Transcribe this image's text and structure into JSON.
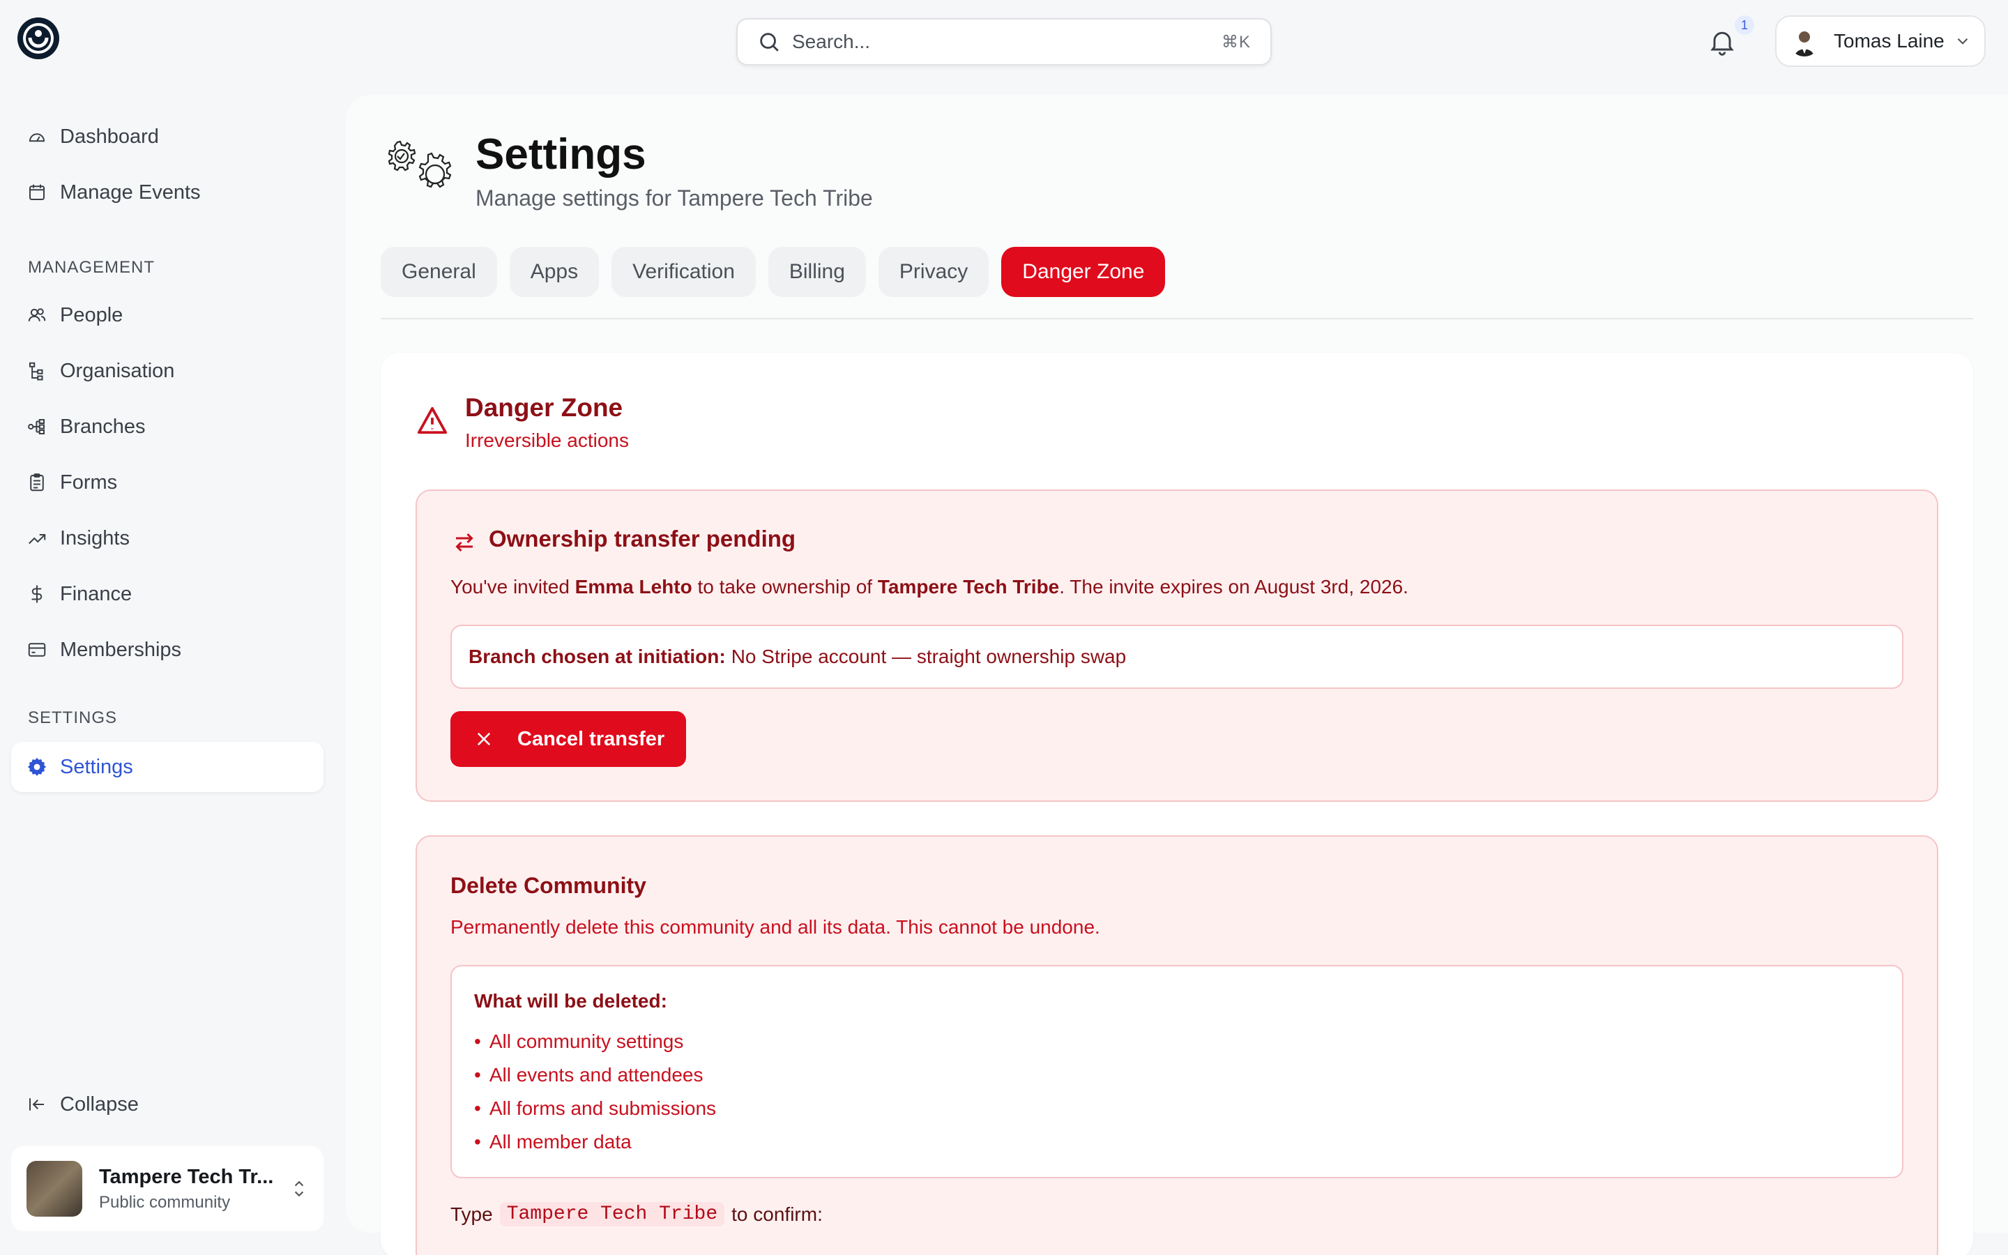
{
  "topbar": {
    "search_placeholder": "Search...",
    "search_shortcut": "⌘K",
    "notification_count": "1",
    "user_name": "Tomas Laine"
  },
  "sidebar": {
    "items_top": [
      {
        "label": "Dashboard",
        "icon": "gauge-icon"
      },
      {
        "label": "Manage Events",
        "icon": "calendar-icon"
      }
    ],
    "management_heading": "MANAGEMENT",
    "management_items": [
      {
        "label": "People",
        "icon": "users-icon"
      },
      {
        "label": "Organisation",
        "icon": "hierarchy-icon"
      },
      {
        "label": "Branches",
        "icon": "branches-icon"
      },
      {
        "label": "Forms",
        "icon": "clipboard-icon"
      },
      {
        "label": "Insights",
        "icon": "trending-up-icon"
      },
      {
        "label": "Finance",
        "icon": "dollar-icon"
      },
      {
        "label": "Memberships",
        "icon": "card-icon"
      }
    ],
    "settings_heading": "SETTINGS",
    "settings_item": {
      "label": "Settings",
      "icon": "gear-icon"
    },
    "collapse_label": "Collapse",
    "community": {
      "name": "Tampere Tech Tr...",
      "type": "Public community"
    }
  },
  "page": {
    "title": "Settings",
    "subtitle": "Manage settings for Tampere Tech Tribe",
    "tabs": [
      "General",
      "Apps",
      "Verification",
      "Billing",
      "Privacy",
      "Danger Zone"
    ],
    "active_tab": "Danger Zone"
  },
  "danger_zone": {
    "title": "Danger Zone",
    "subtitle": "Irreversible actions",
    "ownership": {
      "title": "Ownership transfer pending",
      "text_pre": "You've invited ",
      "invitee": "Emma Lehto",
      "text_mid": " to take ownership of ",
      "community": "Tampere Tech Tribe",
      "text_post": ". The invite expires on August 3rd, 2026.",
      "branch_label": "Branch chosen at initiation:",
      "branch_value": "No Stripe account — straight ownership swap",
      "cancel_label": "Cancel transfer"
    },
    "delete": {
      "title": "Delete Community",
      "text": "Permanently delete this community and all its data. This cannot be undone.",
      "list_heading": "What will be deleted:",
      "list": [
        "All community settings",
        "All events and attendees",
        "All forms and submissions",
        "All member data"
      ],
      "confirm_pre": "Type",
      "confirm_code": "Tampere Tech Tribe",
      "confirm_post": "to confirm:"
    }
  },
  "colors": {
    "accent_red": "#e00b1c",
    "dark_red": "#8c1016",
    "active_blue": "#2f55d4"
  }
}
